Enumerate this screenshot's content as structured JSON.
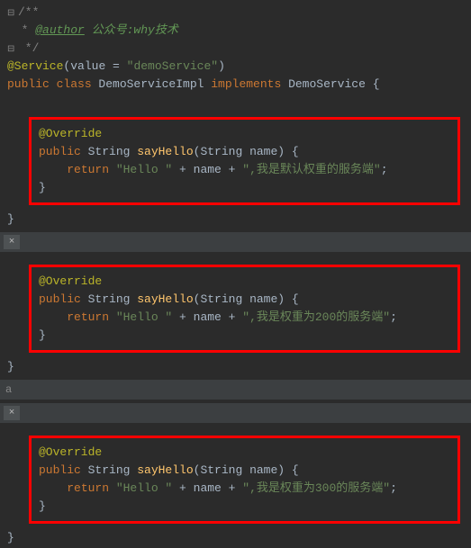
{
  "doc": {
    "open": "/**",
    "author_tag": "@author",
    "author_text": " 公众号:why技术",
    "close": " */"
  },
  "annotation": {
    "name": "@Service",
    "attr_key": "value = ",
    "attr_val": "\"demoService\""
  },
  "class_decl": {
    "kw_public": "public ",
    "kw_class": "class ",
    "name": "DemoServiceImpl ",
    "kw_implements": "implements ",
    "iface": "DemoService ",
    "brace": "{"
  },
  "method_common": {
    "override": "@Override",
    "kw_public": "public ",
    "ret_type": "String ",
    "name": "sayHello",
    "params_open": "(",
    "param_type": "String ",
    "param_name": "name",
    "params_close": ") {",
    "kw_return": "return ",
    "str_hello": "\"Hello \"",
    "plus1": " + ",
    "var": "name",
    "plus2": " + ",
    "close_brace": "}",
    "semicolon": ";"
  },
  "blocks": [
    {
      "tail_string": "\",我是默认权重的服务端\""
    },
    {
      "tail_string": "\",我是权重为200的服务端\""
    },
    {
      "tail_string": "\",我是权重为300的服务端\""
    }
  ],
  "outer_close": "}",
  "tab_label": "a",
  "close_icon": "×",
  "fold_icon": "⊟"
}
